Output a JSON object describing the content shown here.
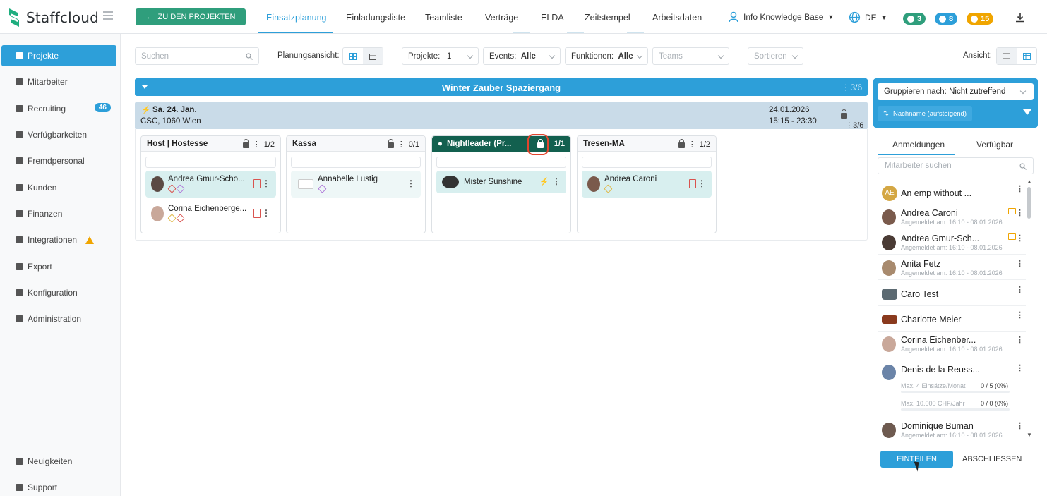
{
  "app": {
    "name": "Staffcloud"
  },
  "topbar": {
    "back_label": "ZU DEN PROJEKTEN",
    "tabs": [
      "Einsatzplanung",
      "Einladungsliste",
      "Teamliste",
      "Verträge",
      "ELDA",
      "Zeitstempel",
      "Arbeitsdaten"
    ],
    "active_tab": "Einsatzplanung",
    "user": "Info Knowledge Base",
    "language": "DE",
    "badges": [
      {
        "name": "messages",
        "count": "3",
        "color": "#2f9e7c"
      },
      {
        "name": "notifications",
        "count": "8",
        "color": "#2d9fd9"
      },
      {
        "name": "alerts",
        "count": "15",
        "color": "#f0a500"
      }
    ]
  },
  "sidebar": {
    "items": [
      {
        "label": "Projekte",
        "active": true
      },
      {
        "label": "Mitarbeiter"
      },
      {
        "label": "Recruiting",
        "badge": "46"
      },
      {
        "label": "Verfügbarkeiten"
      },
      {
        "label": "Fremdpersonal"
      },
      {
        "label": "Kunden"
      },
      {
        "label": "Finanzen"
      },
      {
        "label": "Integrationen",
        "warning": true
      },
      {
        "label": "Export"
      },
      {
        "label": "Konfiguration"
      },
      {
        "label": "Administration"
      }
    ],
    "bottom": [
      {
        "label": "Neuigkeiten"
      },
      {
        "label": "Support"
      }
    ]
  },
  "toolbar": {
    "search_placeholder": "Suchen",
    "planning_label": "Planungsansicht:",
    "projects_label": "Projekte:",
    "projects_value": "1",
    "events_label": "Events:",
    "events_value": "Alle",
    "functions_label": "Funktionen:",
    "functions_value": "Alle",
    "teams_placeholder": "Teams",
    "sort_placeholder": "Sortieren",
    "view_label": "Ansicht:"
  },
  "event": {
    "title": "Winter Zauber Spaziergang",
    "count": "3/6",
    "date_label": "Sa. 24. Jan.",
    "location": "CSC, 1060 Wien",
    "date": "24.01.2026",
    "time": "15:15 - 23:30",
    "shift_count": "3/6"
  },
  "columns": [
    {
      "title": "Host | Hostesse",
      "count": "1/2",
      "dark": false,
      "cards": [
        {
          "name": "Andrea Gmur-Scho...",
          "tags": true,
          "doc": true,
          "filled": true
        },
        {
          "name": "Corina Eichenberge...",
          "tags": true,
          "doc": true,
          "filled": false
        }
      ]
    },
    {
      "title": "Kassa",
      "count": "0/1",
      "dark": false,
      "cards": [
        {
          "name": "Annabelle Lustig",
          "tags": true,
          "filled": true
        }
      ]
    },
    {
      "title": "Nightleader (Pr...",
      "count": "1/1",
      "dark": true,
      "cards": [
        {
          "name": "Mister Sunshine",
          "filled": true
        }
      ]
    },
    {
      "title": "Tresen-MA",
      "count": "1/2",
      "dark": false,
      "cards": [
        {
          "name": "Andrea Caroni",
          "tags": true,
          "doc": true,
          "filled": true
        }
      ]
    }
  ],
  "right_panel": {
    "group_label": "Gruppieren nach:",
    "group_value": "Nicht zutreffend",
    "sort_label": "Nachname (aufsteigend)",
    "tabs": [
      "Anmeldungen",
      "Verfügbar"
    ],
    "search_placeholder": "Mitarbeiter suchen",
    "employees": [
      {
        "name": "An emp without ...",
        "initials": "AE",
        "sub": ""
      },
      {
        "name": "Andrea Caroni",
        "sub": "Angemeldet am: 16:10 - 08.01.2026"
      },
      {
        "name": "Andrea Gmur-Sch...",
        "sub": "Angemeldet am: 16:10 - 08.01.2026"
      },
      {
        "name": "Anita Fetz",
        "sub": "Angemeldet am: 16:10 - 08.01.2026"
      },
      {
        "name": "Caro Test",
        "sub": ""
      },
      {
        "name": "Charlotte Meier",
        "sub": ""
      },
      {
        "name": "Corina Eichenber...",
        "sub": "Angemeldet am: 16:10 - 08.01.2026"
      },
      {
        "name": "Denis de la Reuss...",
        "sub": ""
      },
      {
        "name": "Dominique Buman",
        "sub": "Angemeldet am: 16:10 - 08.01.2026"
      }
    ],
    "stats": [
      {
        "label": "Max. 4 Einsätze/Monat",
        "value": "0 / 5 (0%)"
      },
      {
        "label": "Max. 10.000 CHF/Jahr",
        "value": "0 / 0 (0%)"
      }
    ],
    "assign_label": "EINTEILEN",
    "close_label": "ABSCHLIESSEN"
  }
}
